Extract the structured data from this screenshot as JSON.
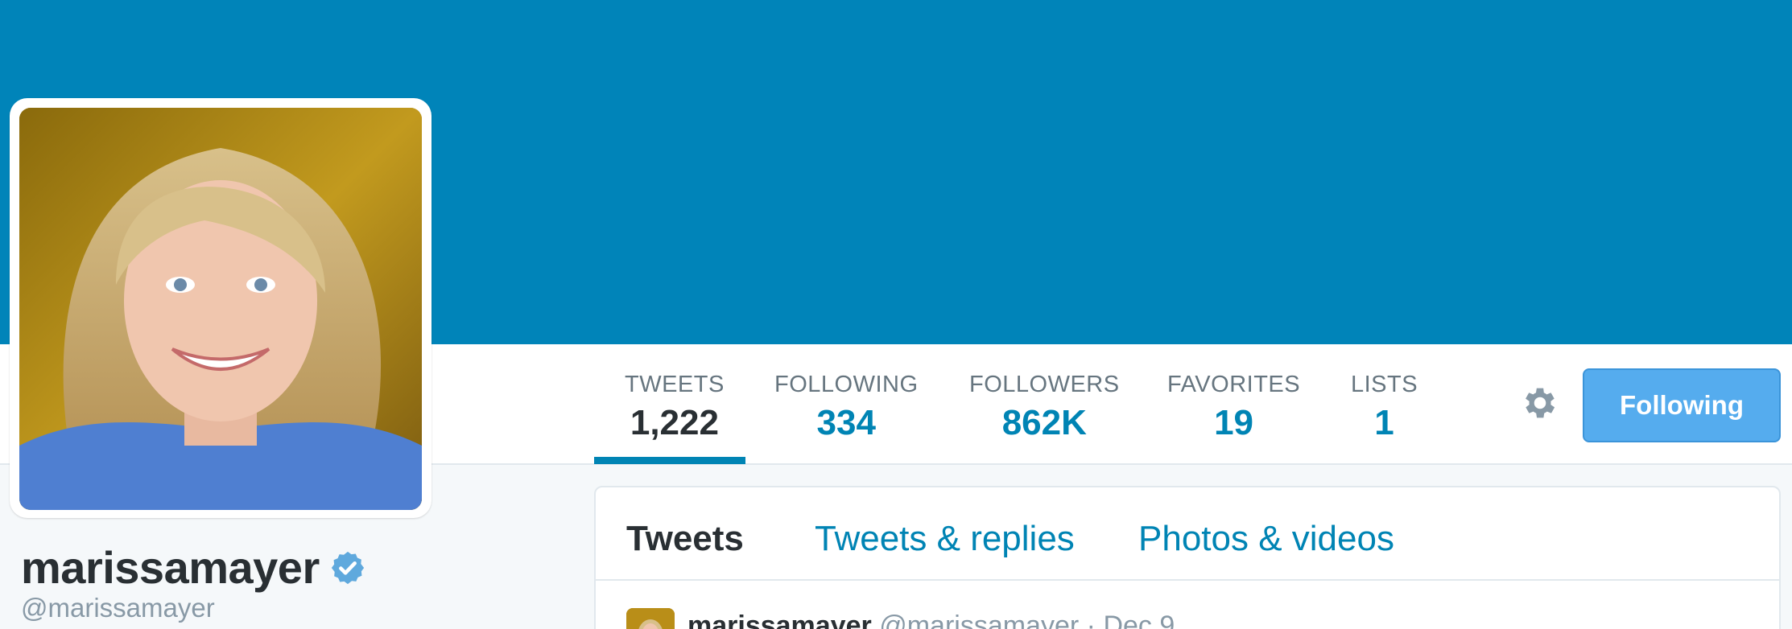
{
  "profile": {
    "display_name": "marissamayer",
    "handle": "@marissamayer",
    "verified": true,
    "avatar": "profile-photo-blonde-woman",
    "banner_color": "#0084b9"
  },
  "stats": [
    {
      "label": "TWEETS",
      "value": "1,222",
      "active": true
    },
    {
      "label": "FOLLOWING",
      "value": "334",
      "active": false
    },
    {
      "label": "FOLLOWERS",
      "value": "862K",
      "active": false
    },
    {
      "label": "FAVORITES",
      "value": "19",
      "active": false
    },
    {
      "label": "LISTS",
      "value": "1",
      "active": false
    }
  ],
  "actions": {
    "settings_icon": "gear-icon",
    "follow_button_label": "Following"
  },
  "timeline": {
    "tabs": [
      {
        "label": "Tweets",
        "active": true
      },
      {
        "label": "Tweets & replies",
        "active": false
      },
      {
        "label": "Photos & videos",
        "active": false
      }
    ],
    "first_tweet": {
      "name": "marissamayer",
      "handle": "@marissamayer",
      "separator": "·",
      "date": "Dec 9"
    }
  },
  "colors": {
    "accent": "#0084b4",
    "button": "#55acee",
    "text_dark": "#292f33",
    "text_muted": "#8899a6"
  }
}
